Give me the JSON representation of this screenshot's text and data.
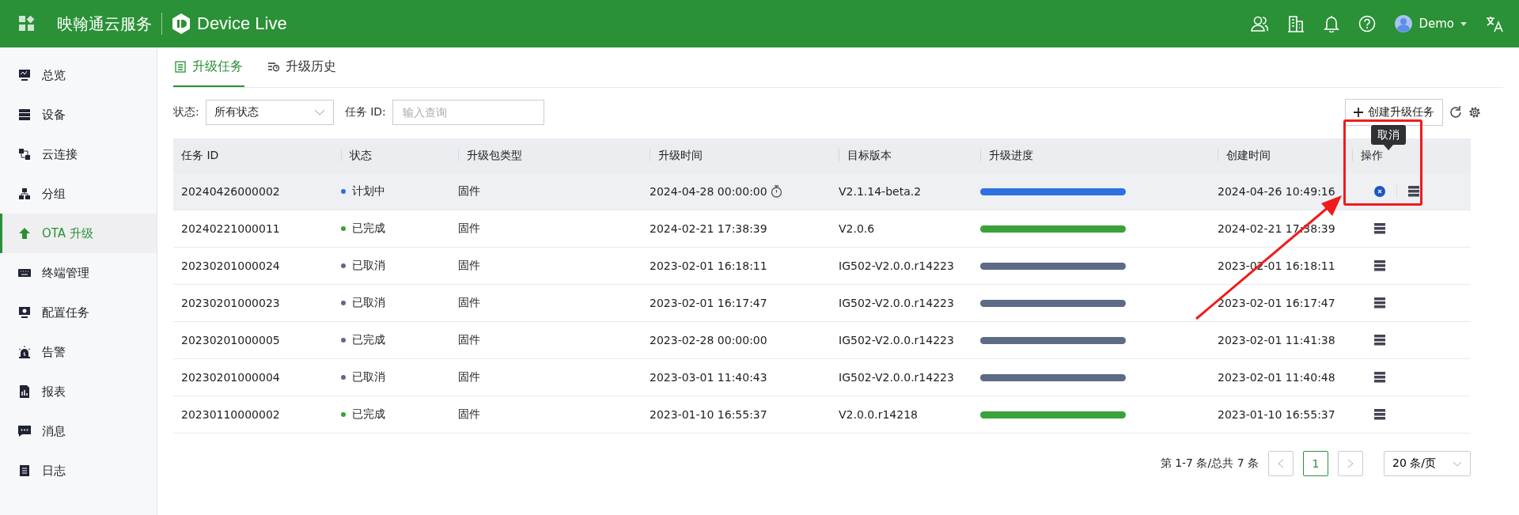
{
  "topbar": {
    "brand": "映翰通云服务",
    "product": "Device Live",
    "user": "Demo"
  },
  "sidebar": {
    "items": [
      {
        "label": "总览",
        "selected": false
      },
      {
        "label": "设备",
        "selected": false
      },
      {
        "label": "云连接",
        "selected": false
      },
      {
        "label": "分组",
        "selected": false
      },
      {
        "label": "OTA 升级",
        "selected": true
      },
      {
        "label": "终端管理",
        "selected": false
      },
      {
        "label": "配置任务",
        "selected": false
      },
      {
        "label": "告警",
        "selected": false
      },
      {
        "label": "报表",
        "selected": false
      },
      {
        "label": "消息",
        "selected": false
      },
      {
        "label": "日志",
        "selected": false
      }
    ]
  },
  "tabs": [
    {
      "label": "升级任务",
      "selected": true
    },
    {
      "label": "升级历史",
      "selected": false
    }
  ],
  "filters": {
    "status_label": "状态:",
    "status_value": "所有状态",
    "id_label": "任务 ID:",
    "id_placeholder": "输入查询"
  },
  "create_button": "创建升级任务",
  "table": {
    "columns": [
      "任务 ID",
      "状态",
      "升级包类型",
      "升级时间",
      "目标版本",
      "升级进度",
      "创建时间",
      "操作"
    ],
    "rows": [
      {
        "id": "20240426000002",
        "status": "计划中",
        "color": "#2f6fe0",
        "type": "固件",
        "time": "2024-04-28 00:00:00",
        "scheduled": true,
        "version": "V2.1.14-beta.2",
        "level": 1,
        "created": "2024-04-26 10:49:16",
        "cancelable": true,
        "highlighted": true
      },
      {
        "id": "20240221000011",
        "status": "已完成",
        "color": "#3aa23a",
        "type": "固件",
        "time": "2024-02-21 17:38:39",
        "scheduled": false,
        "version": "V2.0.6",
        "level": 1,
        "created": "2024-02-21 17:38:39",
        "cancelable": false,
        "highlighted": false
      },
      {
        "id": "20230201000024",
        "status": "已取消",
        "color": "#5d6b84",
        "type": "固件",
        "time": "2023-02-01 16:18:11",
        "scheduled": false,
        "version": "IG502-V2.0.0.r14223",
        "level": 1,
        "created": "2023-02-01 16:18:11",
        "cancelable": false,
        "highlighted": false
      },
      {
        "id": "20230201000023",
        "status": "已取消",
        "color": "#5d6b84",
        "type": "固件",
        "time": "2023-02-01 16:17:47",
        "scheduled": false,
        "version": "IG502-V2.0.0.r14223",
        "level": 1,
        "created": "2023-02-01 16:17:47",
        "cancelable": false,
        "highlighted": false
      },
      {
        "id": "20230201000005",
        "status": "已完成",
        "color": "#5d6b84",
        "type": "固件",
        "time": "2023-02-28 00:00:00",
        "scheduled": false,
        "version": "IG502-V2.0.0.r14223",
        "level": 1,
        "created": "2023-02-01 11:41:38",
        "cancelable": false,
        "highlighted": false
      },
      {
        "id": "20230201000004",
        "status": "已取消",
        "color": "#5d6b84",
        "type": "固件",
        "time": "2023-03-01 11:40:43",
        "scheduled": false,
        "version": "IG502-V2.0.0.r14223",
        "level": 1,
        "created": "2023-02-01 11:40:48",
        "cancelable": false,
        "highlighted": false
      },
      {
        "id": "20230110000002",
        "status": "已完成",
        "color": "#3aa23a",
        "type": "固件",
        "time": "2023-01-10 16:55:37",
        "scheduled": false,
        "version": "V2.0.0.r14218",
        "level": 1,
        "created": "2023-01-10 16:55:37",
        "cancelable": false,
        "highlighted": false
      }
    ]
  },
  "tooltip": "取消",
  "pagination": {
    "summary": "第 1-7 条/总共 7 条",
    "pages": [
      {
        "label": "1",
        "selected": true
      }
    ],
    "page_size": "20 条/页"
  }
}
